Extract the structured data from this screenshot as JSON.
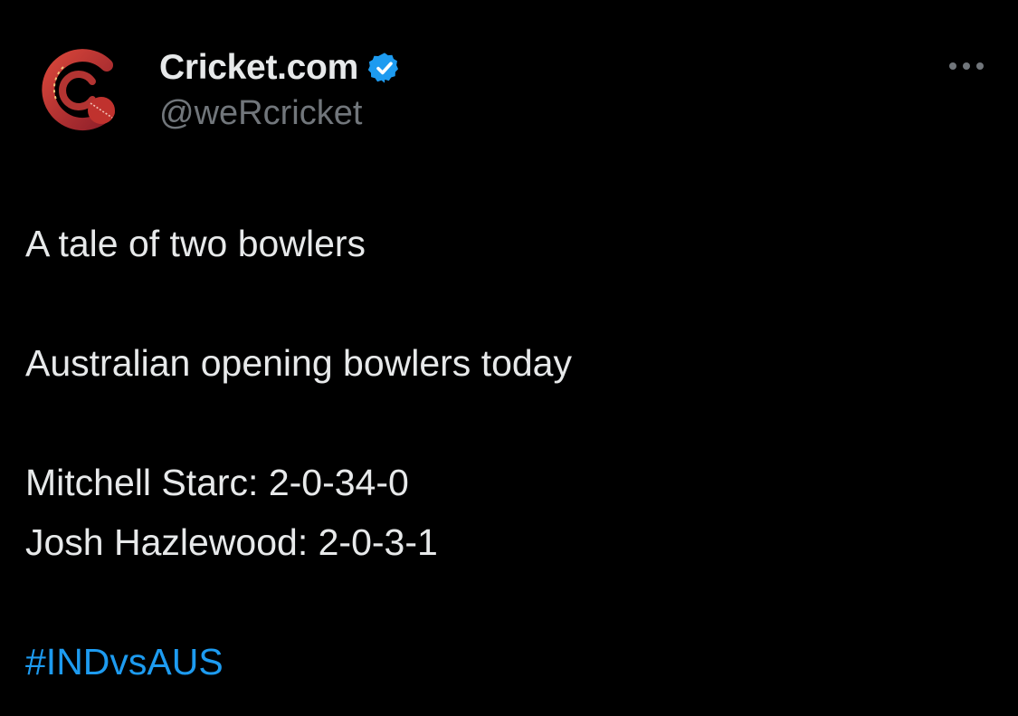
{
  "author": {
    "display_name": "Cricket.com",
    "handle": "@weRcricket",
    "verified": true,
    "avatar_icon": "cricket-com-logo-icon"
  },
  "menu": {
    "icon": "more-horizontal-icon"
  },
  "tweet": {
    "lines": [
      "A tale of two bowlers",
      "",
      "Australian opening bowlers today",
      "",
      "Mitchell Starc: 2-0-34-0",
      "Josh Hazlewood: 2-0-3-1",
      "",
      "#INDvsAUS"
    ]
  },
  "colors": {
    "background": "#000000",
    "text": "#e7e9ea",
    "secondary_text": "#71767b",
    "hashtag": "#1d9bf0",
    "verified_badge": "#1d9bf0",
    "logo_red": "#c0322e"
  }
}
